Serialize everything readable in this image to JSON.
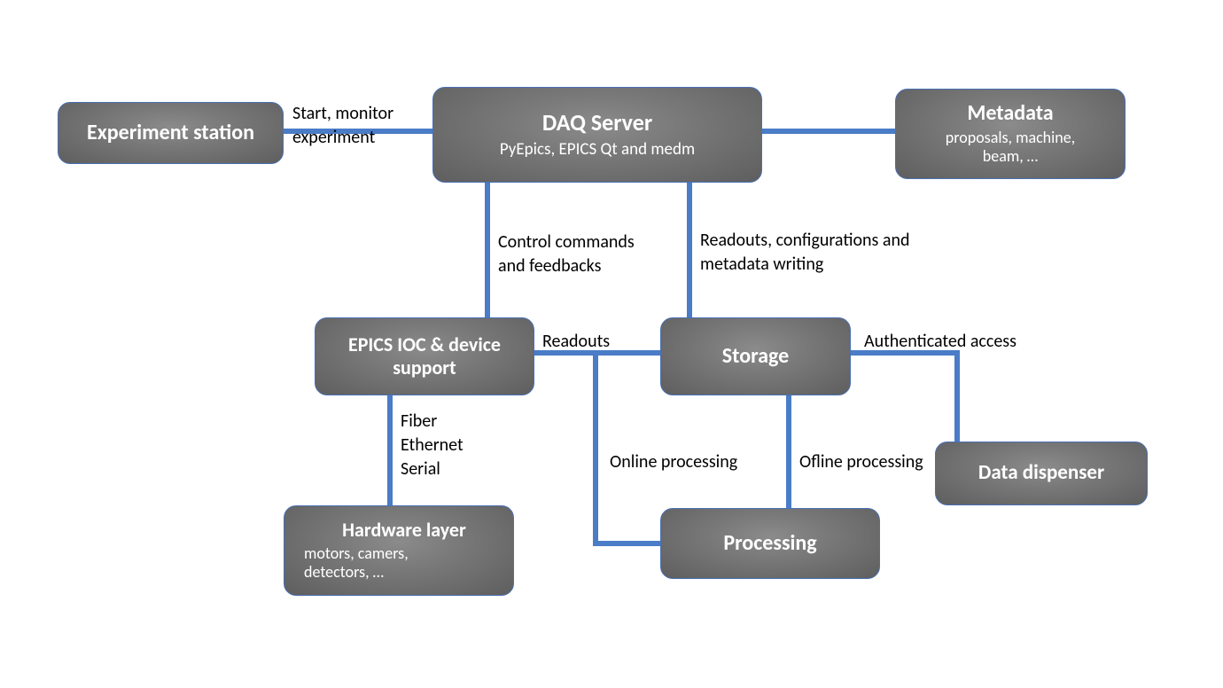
{
  "nodes": {
    "experiment_station": {
      "title": "Experiment station",
      "subtitle": ""
    },
    "daq_server": {
      "title": "DAQ Server",
      "subtitle": "PyEpics, EPICS Qt and medm"
    },
    "metadata": {
      "title": "Metadata",
      "subtitle": "proposals, machine,\nbeam, …"
    },
    "epics_ioc": {
      "title": "EPICS IOC & device support",
      "subtitle": ""
    },
    "storage": {
      "title": "Storage",
      "subtitle": ""
    },
    "hardware": {
      "title": "Hardware layer",
      "subtitle": "motors, camers,\ndetectors, …"
    },
    "processing": {
      "title": "Processing",
      "subtitle": ""
    },
    "data_dispenser": {
      "title": "Data dispenser",
      "subtitle": ""
    }
  },
  "edges": {
    "exp_to_daq": "Start, monitor\nexperiment",
    "daq_to_ioc": "Control commands\nand feedbacks",
    "daq_to_storage": "Readouts, configurations and\nmetadata writing",
    "ioc_to_storage": "Readouts",
    "ioc_to_hardware": "Fiber\nEthernet\nSerial",
    "mid_to_processing": "Online processing",
    "storage_to_proc": "Ofline processing",
    "storage_to_disp": "Authenticated access"
  },
  "colors": {
    "line": "#4a7cc7",
    "node_border": "#4a6fb5",
    "node_fill": "#6f6f6f",
    "text_light": "#ffffff",
    "text_dark": "#000000"
  }
}
